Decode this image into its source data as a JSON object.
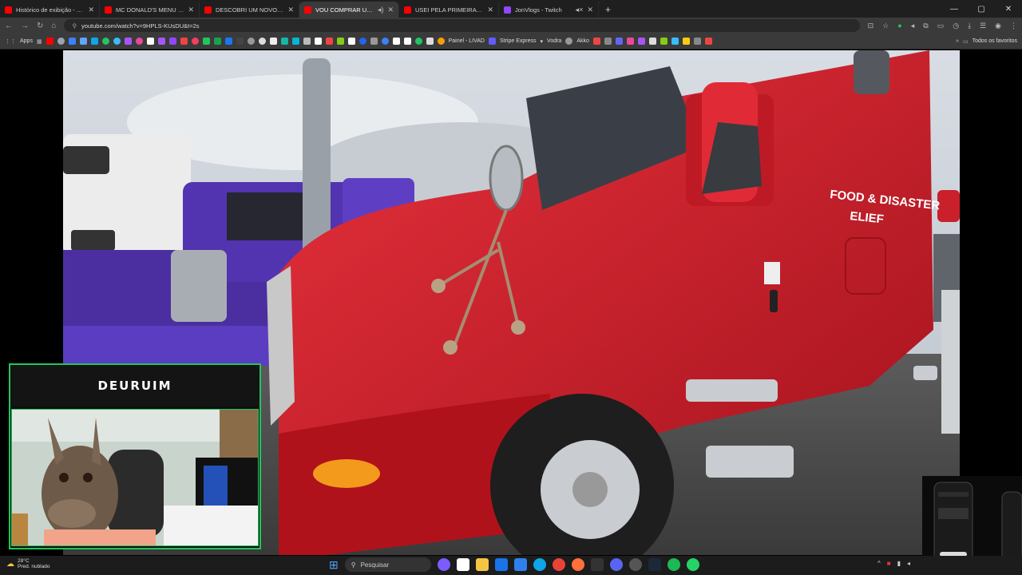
{
  "tabs": [
    {
      "title": "Histórico de exibição - YouTube",
      "color": "#ff0000",
      "active": false
    },
    {
      "title": "MC DONALD'S MENU GLOBAL",
      "color": "#ff0000",
      "active": false
    },
    {
      "title": "DESCOBRI UM NOVO FASTFOOD",
      "color": "#ff0000",
      "active": false
    },
    {
      "title": "VOU COMPRAR UM CAMINHÃO",
      "color": "#ff0000",
      "active": true
    },
    {
      "title": "USEI PELA PRIMEIRA VEZ MEU",
      "color": "#ff0000",
      "active": false
    },
    {
      "title": "JonVlogs - Twitch",
      "color": "#9146ff",
      "active": false
    }
  ],
  "address": {
    "url": "youtube.com/watch?v=9HPLS-KUsDU&t=2s"
  },
  "bookmarks": {
    "apps_label": "Apps",
    "painel": "Painel - LIVAD",
    "stripe": "Stripe Express",
    "vodra": "Vodra",
    "akiko": "Akko",
    "favorites": "Todos os favoritos"
  },
  "video": {
    "truck_text_line1": "FOOD & DISASTER",
    "truck_text_line2": "ELIEF"
  },
  "webcam": {
    "streamer_name": "DEURUIM"
  },
  "taskbar": {
    "weather_temp": "28°C",
    "weather_desc": "Pred. nublado",
    "search_label": "Pesquisar"
  },
  "colors": {
    "accent": "#22c55e",
    "truck_red": "#d61f2c",
    "truck_purple": "#4b2fa0"
  }
}
